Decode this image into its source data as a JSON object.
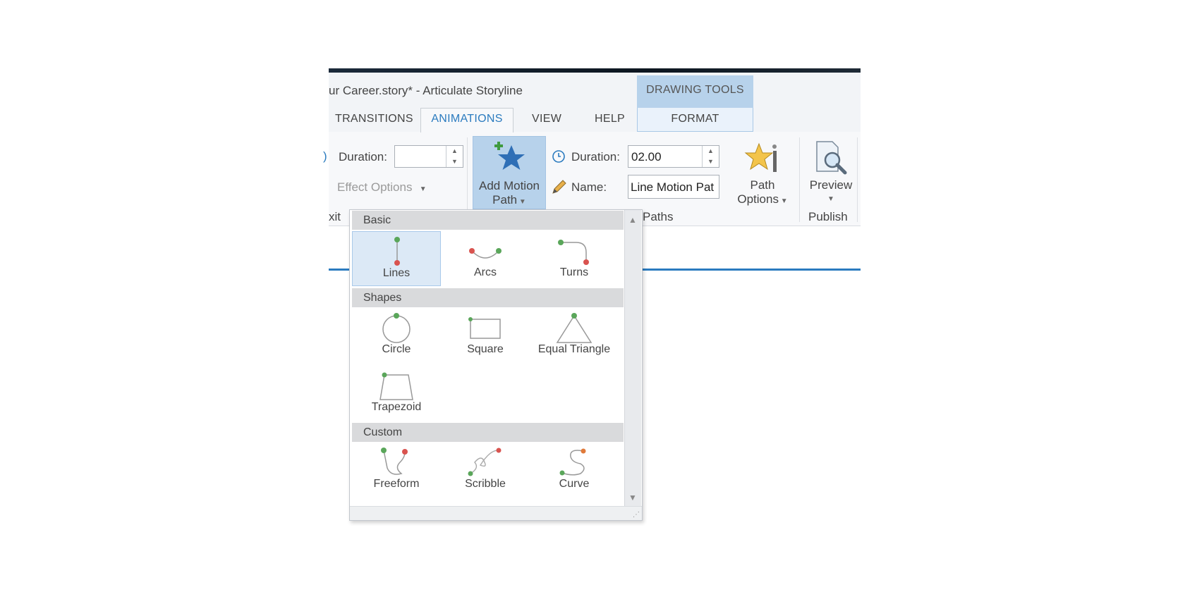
{
  "window": {
    "title": "ur Career.story* -  Articulate Storyline",
    "contextual_group": "DRAWING TOOLS"
  },
  "tabs": [
    {
      "label": "TRANSITIONS"
    },
    {
      "label": "ANIMATIONS",
      "active": true
    },
    {
      "label": "VIEW"
    },
    {
      "label": "HELP"
    },
    {
      "label": "FORMAT"
    }
  ],
  "ribbon": {
    "exit": {
      "duration_label": "Duration:",
      "duration_value": "",
      "effect_options_label": "Effect Options",
      "group_label": "xit"
    },
    "motion_paths": {
      "add_motion_path_label_1": "Add Motion",
      "add_motion_path_label_2": "Path",
      "duration_label": "Duration:",
      "duration_value": "02.00",
      "name_label": "Name:",
      "name_value": "Line Motion Pat",
      "path_options_label_1": "Path",
      "path_options_label_2": "Options",
      "group_label": "Paths"
    },
    "publish": {
      "preview_label": "Preview",
      "group_label": "Publish"
    }
  },
  "dropdown": {
    "sections": [
      {
        "title": "Basic",
        "items": [
          {
            "label": "Lines",
            "icon": "line-path-icon",
            "selected": true
          },
          {
            "label": "Arcs",
            "icon": "arc-path-icon"
          },
          {
            "label": "Turns",
            "icon": "turn-path-icon"
          }
        ]
      },
      {
        "title": "Shapes",
        "items": [
          {
            "label": "Circle",
            "icon": "circle-path-icon"
          },
          {
            "label": "Square",
            "icon": "square-path-icon"
          },
          {
            "label": "Equal Triangle",
            "icon": "triangle-path-icon"
          },
          {
            "label": "Trapezoid",
            "icon": "trapezoid-path-icon"
          }
        ]
      },
      {
        "title": "Custom",
        "items": [
          {
            "label": "Freeform",
            "icon": "freeform-path-icon"
          },
          {
            "label": "Scribble",
            "icon": "scribble-path-icon"
          },
          {
            "label": "Curve",
            "icon": "curve-path-icon"
          }
        ]
      }
    ]
  },
  "colors": {
    "accent": "#2b7bbf",
    "contextual_band": "#b7d2eb",
    "start_dot": "#5aa65a",
    "end_dot": "#d9534f"
  }
}
